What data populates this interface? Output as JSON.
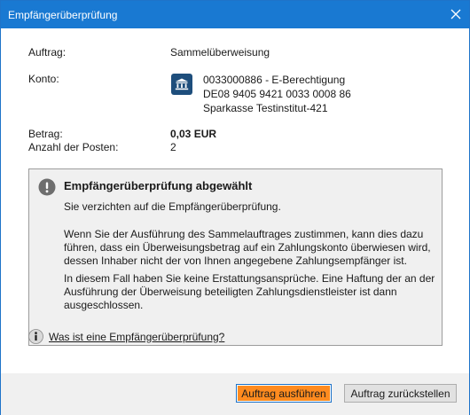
{
  "window": {
    "title": "Empfängerüberprüfung"
  },
  "details": {
    "auftrag_label": "Auftrag:",
    "auftrag_value": "Sammelüberweisung",
    "konto_label": "Konto:",
    "konto_lines": [
      "0033000886 - E-Berechtigung",
      "DE08 9405 9421 0033 0008 86",
      "Sparkasse Testinstitut-421"
    ],
    "betrag_label": "Betrag:",
    "betrag_value": "0,03 EUR",
    "posten_label": "Anzahl der Posten:",
    "posten_value": "2"
  },
  "warning": {
    "title": "Empfängerüberprüfung abgewählt",
    "p1": "Sie verzichten auf die Empfängerüberprüfung.",
    "p2": "Wenn Sie der Ausführung des Sammelauftrages zustimmen, kann dies dazu führen, dass ein Überweisungsbetrag auf ein Zahlungskonto überwiesen wird, dessen Inhaber nicht der von Ihnen angegebene Zahlungsempfänger ist.",
    "p3": "In diesem Fall haben Sie keine Erstattungsansprüche. Eine Haftung der an der Ausführung der Überweisung beteiligten Zahlungsdienstleister ist dann ausgeschlossen."
  },
  "help": {
    "link_text": "Was ist eine Empfängerüberprüfung?"
  },
  "buttons": {
    "execute": "Auftrag ausführen",
    "defer": "Auftrag zurückstellen"
  },
  "colors": {
    "titlebar": "#1979d2",
    "primary_button": "#ff8b1f",
    "bank_icon": "#1e4e7c",
    "footer": "#f0f0f0"
  },
  "icons": {
    "close": "close-icon",
    "bank": "bank-icon",
    "warning": "exclamation-circle-icon",
    "info": "info-icon"
  }
}
